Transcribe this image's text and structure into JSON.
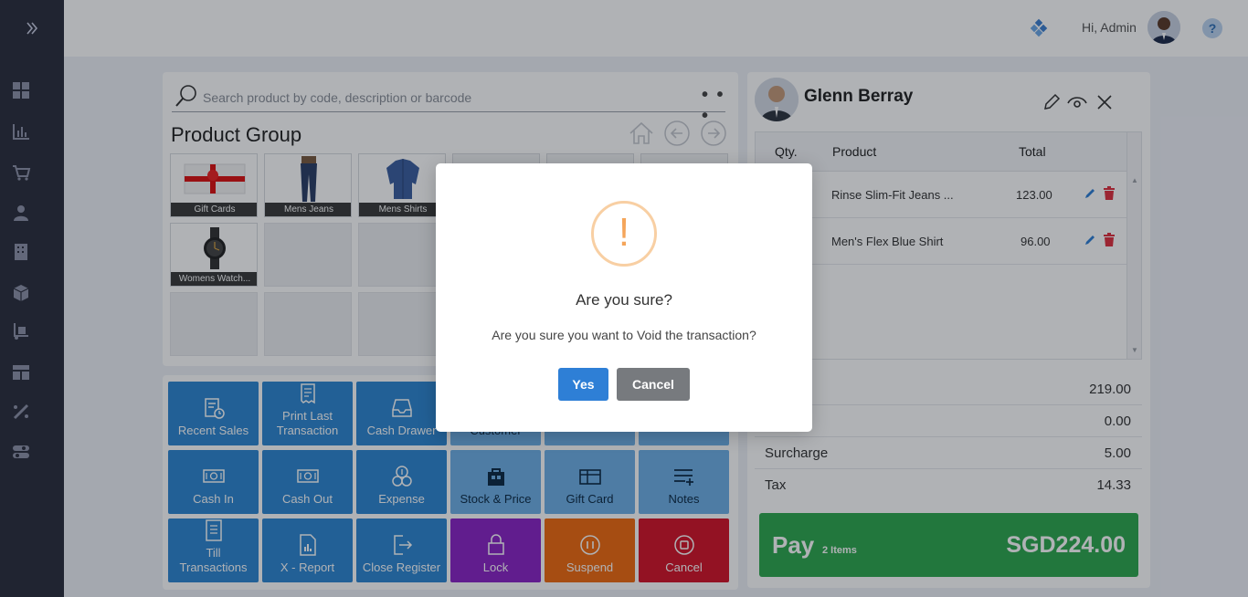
{
  "header": {
    "greeting": "Hi, Admin"
  },
  "search": {
    "placeholder": "Search product by code, description or barcode",
    "more": "• • •"
  },
  "product_group": {
    "title": "Product Group",
    "tiles": [
      "Gift Cards",
      "Mens Jeans",
      "Mens Shirts",
      "Womens Watch..."
    ]
  },
  "actions": {
    "recent_sales": "Recent Sales",
    "print_last_1": "Print Last",
    "print_last_2": "Transaction",
    "cash_drawer": "Cash Drawer",
    "customer": "Customer",
    "cash_in": "Cash In",
    "cash_out": "Cash Out",
    "expense": "Expense",
    "stock_price": "Stock & Price",
    "gift_card": "Gift Card",
    "notes": "Notes",
    "till_1": "Till",
    "till_2": "Transactions",
    "x_report": "X - Report",
    "close_register": "Close Register",
    "lock": "Lock",
    "suspend": "Suspend",
    "cancel": "Cancel"
  },
  "cart": {
    "customer_name": "Glenn Berray",
    "columns": {
      "qty": "Qty.",
      "product": "Product",
      "total": "Total"
    },
    "items": [
      {
        "product": "Rinse Slim-Fit Jeans ...",
        "total": "123.00"
      },
      {
        "product": "Men's Flex Blue Shirt",
        "total": "96.00"
      }
    ],
    "summary": [
      {
        "label": "al",
        "value": "219.00"
      },
      {
        "label": "nt",
        "value": "0.00"
      },
      {
        "label": "Surcharge",
        "value": "5.00"
      },
      {
        "label": "Tax",
        "value": "14.33"
      }
    ],
    "pay": {
      "label": "Pay",
      "count": "2 Items",
      "total": "SGD224.00"
    }
  },
  "modal": {
    "icon": "!",
    "title": "Are you sure?",
    "text": "Are you sure you want to Void the transaction?",
    "yes": "Yes",
    "cancel": "Cancel"
  },
  "colors": {
    "sidebar": "#2b2e3d",
    "primary": "#2e86d1",
    "pay": "#2ea84e",
    "lock": "#8b24c6",
    "suspend": "#f06a10",
    "void": "#d41428"
  }
}
